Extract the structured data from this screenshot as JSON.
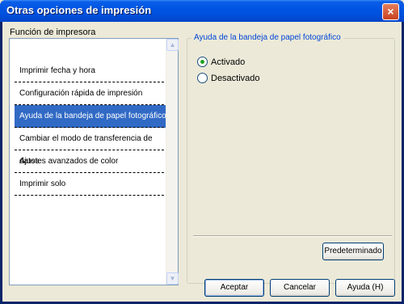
{
  "window": {
    "title": "Otras opciones de impresión",
    "close_glyph": "×"
  },
  "function_section": {
    "label": "Función de impresora",
    "items": [
      {
        "label": "Imprimir fecha y hora"
      },
      {
        "label": "Configuración rápida de impresión"
      },
      {
        "label": "Ayuda de la bandeja de papel fotográfico",
        "selected": true
      },
      {
        "label": "Cambiar el modo de transferencia de datos"
      },
      {
        "label": "Ajustes avanzados de color"
      },
      {
        "label": "Imprimir solo"
      }
    ]
  },
  "photo_tray_group": {
    "title": "Ayuda de la bandeja de papel fotográfico",
    "options": [
      {
        "label": "Activado",
        "checked": true
      },
      {
        "label": "Desactivado",
        "checked": false
      }
    ],
    "default_button": "Predeterminado"
  },
  "footer": {
    "accept": "Aceptar",
    "cancel": "Cancelar",
    "help": "Ayuda (H)"
  },
  "colors": {
    "title_bar": "#0054e3",
    "selection": "#316ac5",
    "radio_dot": "#21a121"
  },
  "icons": {
    "close": "close-icon",
    "radio": "radio-icon",
    "scroll_up": "scroll-up-arrow-icon",
    "scroll_down": "scroll-down-arrow-icon"
  }
}
